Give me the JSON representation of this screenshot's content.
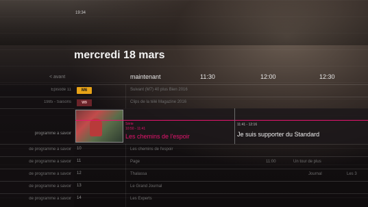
{
  "header": {
    "clock": "19:34",
    "date": "mercredi 18 mars"
  },
  "timeline": {
    "back": "< avant",
    "now": "maintenant",
    "slots": [
      "11:30",
      "12:00",
      "12:30"
    ]
  },
  "channels": [
    {
      "left": "Episode 11",
      "logo": "M6",
      "programs": [
        {
          "title": "Suivant (M7) 40 plus Bien 2016"
        }
      ]
    },
    {
      "left": "1985 - Saisons",
      "logo": "W9",
      "programs": [
        {
          "title": "Clips de la télé Magazine 2016"
        }
      ]
    }
  ],
  "selected": {
    "left": "programme à savoir",
    "meta1": "Série",
    "meta2": "10:50 - 11:41",
    "title": "Les chemins de l'espoir",
    "next_time": "11:41 - 12:16",
    "next_title": "Je suis supporter du Standard"
  },
  "rows": [
    {
      "left": "de programme à savoir",
      "logo": "10",
      "programs": [
        {
          "title": "Les chemins de l'espoir"
        }
      ]
    },
    {
      "left": "de programme à savoir",
      "logo": "11",
      "programs": [
        {
          "title": "Page"
        },
        {
          "title": "11:00"
        },
        {
          "title": "Un tour de plus"
        }
      ]
    },
    {
      "left": "de programme à savoir",
      "logo": "12",
      "programs": [
        {
          "title": "Thalassa"
        },
        {
          "title": "Journal"
        },
        {
          "title": "Les 3"
        }
      ]
    },
    {
      "left": "de programme à savoir",
      "logo": "13",
      "programs": [
        {
          "title": "Le Grand Journal"
        }
      ]
    },
    {
      "left": "de programme à savoir",
      "logo": "14",
      "programs": [
        {
          "title": "Les Experts"
        }
      ]
    }
  ]
}
